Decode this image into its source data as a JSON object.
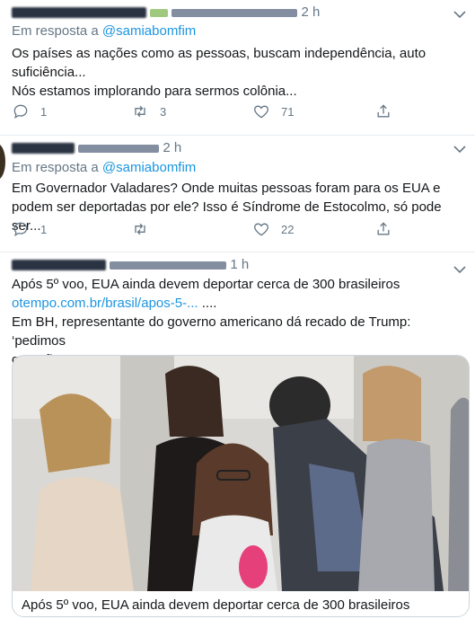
{
  "tweets": [
    {
      "time": "2 h",
      "reply_prefix": "Em resposta a",
      "reply_handle": "@samiabomfim",
      "lines": [
        "Os países as nações como as pessoas, buscam independência, auto",
        "suficiência...",
        "Nós estamos implorando para sermos colônia..."
      ],
      "replies": "1",
      "retweets": "3",
      "likes": "71"
    },
    {
      "time": "2 h",
      "reply_prefix": "Em resposta a",
      "reply_handle": "@samiabomfim",
      "lines": [
        "Em Governador Valadares? Onde muitas pessoas foram para os EUA e",
        "podem ser deportadas por ele? Isso é Síndrome de Estocolmo, só pode ser..."
      ],
      "replies": "1",
      "retweets": "",
      "likes": "22"
    },
    {
      "time": "1 h",
      "line1": "Após 5º voo, EUA ainda devem deportar cerca de 300 brasileiros",
      "link": "otempo.com.br/brasil/apos-5-...",
      "link_suffix": " ....",
      "line3": "Em BH, representante do governo americano dá recado de Trump: ‘pedimos",
      "line4": "que não tentem’",
      "card_title": "Após 5º voo, EUA ainda devem deportar cerca de 300 brasileiros"
    }
  ],
  "icons": [
    "reply-icon",
    "retweet-icon",
    "like-icon",
    "share-icon",
    "chevron-down-icon"
  ]
}
